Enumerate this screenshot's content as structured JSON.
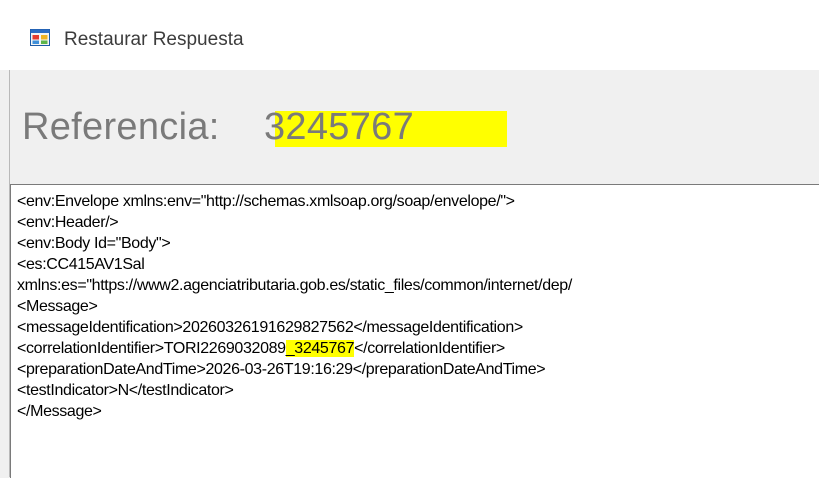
{
  "window": {
    "title": "Restaurar Respuesta",
    "icon": "form-app-icon"
  },
  "reference": {
    "label": "Referencia:",
    "value": "3245767"
  },
  "xml": {
    "lines": [
      "<env:Envelope xmlns:env=\"http://schemas.xmlsoap.org/soap/envelope/\">",
      "<env:Header/>",
      "<env:Body Id=\"Body\">",
      "<es:CC415AV1Sal",
      "xmlns:es=\"https://www2.agenciatributaria.gob.es/static_files/common/internet/dep/",
      "<Message>",
      "<messageIdentification>20260326191629827562</messageIdentification>",
      "<correlationIdentifier>TORI2269032089",
      "<preparationDateAndTime>2026-03-26T19:16:29</preparationDateAndTime>",
      "<testIndicator>N</testIndicator>",
      "</Message>"
    ],
    "correlation_highlight": "_3245767",
    "correlation_suffix": "</correlationIdentifier>"
  },
  "colors": {
    "highlight": "#ffff00",
    "label_gray": "#7a7a7a"
  }
}
